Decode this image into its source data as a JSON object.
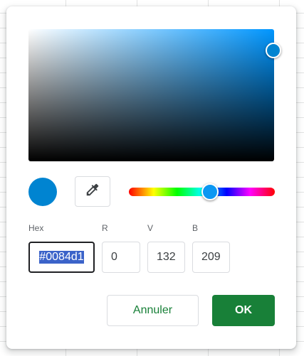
{
  "picker": {
    "selected_color": "#0084d1",
    "hue_color": "#0096ff",
    "hue_fraction": 0.56,
    "saturation": 1.0,
    "brightness": 0.82
  },
  "fields": {
    "hex_label": "Hex",
    "hex_value": "#0084d1",
    "r_label": "R",
    "r_value": "0",
    "v_label": "V",
    "v_value": "132",
    "b_label": "B",
    "b_value": "209"
  },
  "icons": {
    "eyedropper": "eyedropper-icon"
  },
  "buttons": {
    "cancel_label": "Annuler",
    "ok_label": "OK"
  },
  "colors": {
    "accent_green": "#188038",
    "handle_blue": "#0b97f2"
  }
}
